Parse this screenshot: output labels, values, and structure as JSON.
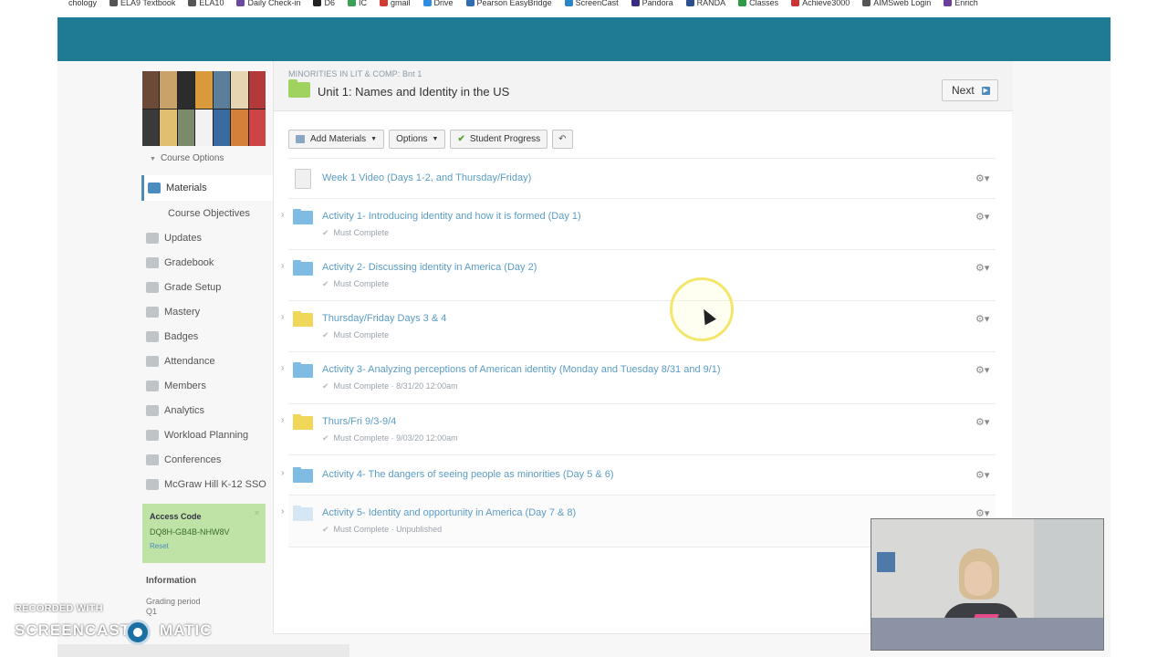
{
  "bookmarks": [
    {
      "label": "chology",
      "color": "#ffffff"
    },
    {
      "label": "ELA9 Textbook",
      "color": "#555555"
    },
    {
      "label": "ELA10",
      "color": "#555555"
    },
    {
      "label": "Daily Check-in",
      "color": "#6a4aa0"
    },
    {
      "label": "D6",
      "color": "#222222"
    },
    {
      "label": "IC",
      "color": "#3aa056"
    },
    {
      "label": "gmail",
      "color": "#d23c30"
    },
    {
      "label": "Drive",
      "color": "#2f8de2"
    },
    {
      "label": "Pearson EasyBridge",
      "color": "#2f6db0"
    },
    {
      "label": "ScreenCast",
      "color": "#2a84c6"
    },
    {
      "label": "Pandora",
      "color": "#3a2a80"
    },
    {
      "label": "RANDA",
      "color": "#2c4f8f"
    },
    {
      "label": "Classes",
      "color": "#2f9b46"
    },
    {
      "label": "Achieve3000",
      "color": "#cc3333"
    },
    {
      "label": "AIMSweb Login",
      "color": "#555555"
    },
    {
      "label": "Enrich",
      "color": "#6a3f9c"
    }
  ],
  "colors": {
    "header_band": "#1f7a94",
    "link": "#5a9cc4",
    "access_bg": "#bfe3a6"
  },
  "sidebar": {
    "course_options": "Course Options",
    "items": [
      {
        "label": "Materials",
        "icon": "materials-icon",
        "active": true
      },
      {
        "label": "Course Objectives",
        "icon": "",
        "sub": true
      },
      {
        "label": "Updates",
        "icon": "updates-icon"
      },
      {
        "label": "Gradebook",
        "icon": "gradebook-icon"
      },
      {
        "label": "Grade Setup",
        "icon": "grade-setup-icon"
      },
      {
        "label": "Mastery",
        "icon": "mastery-icon"
      },
      {
        "label": "Badges",
        "icon": "badges-icon"
      },
      {
        "label": "Attendance",
        "icon": "attendance-icon"
      },
      {
        "label": "Members",
        "icon": "members-icon"
      },
      {
        "label": "Analytics",
        "icon": "analytics-icon"
      },
      {
        "label": "Workload Planning",
        "icon": "workload-icon"
      },
      {
        "label": "Conferences",
        "icon": "conferences-icon"
      },
      {
        "label": "McGraw Hill K-12 SSO",
        "icon": "mcgraw-hill-icon"
      }
    ],
    "access_code": {
      "title": "Access Code",
      "code": "DQ8H-GB4B-NHW8V",
      "reset": "Reset"
    },
    "information": "Information",
    "grading_period": "Grading period",
    "grading_value": "Q1"
  },
  "header": {
    "breadcrumb": "MINORITIES IN LIT & COMP: Bnt 1",
    "title": "Unit 1: Names and Identity in the US",
    "next": "Next"
  },
  "toolbar": {
    "add_materials": "Add Materials",
    "options": "Options",
    "student_progress": "Student Progress"
  },
  "materials": [
    {
      "title": "Week 1 Video (Days 1-2, and Thursday/Friday)",
      "meta": "",
      "type": "doc"
    },
    {
      "title": "Activity 1- Introducing identity and how it is formed (Day 1)",
      "meta": "Must Complete",
      "type": "blue"
    },
    {
      "title": "Activity 2- Discussing identity in America (Day 2)",
      "meta": "Must Complete",
      "type": "blue"
    },
    {
      "title": "Thursday/Friday Days 3 & 4",
      "meta": "Must Complete",
      "type": "yellow"
    },
    {
      "title": "Activity 3- Analyzing perceptions of American identity (Monday and Tuesday 8/31 and 9/1)",
      "meta": "Must Complete · 8/31/20 12:00am",
      "type": "blue"
    },
    {
      "title": "Thurs/Fri 9/3-9/4",
      "meta": "Must Complete · 9/03/20 12:00am",
      "type": "yellow"
    },
    {
      "title": "Activity 4- The dangers of seeing people as minorities (Day 5 & 6)",
      "meta": "",
      "type": "blue"
    },
    {
      "title": "Activity 5- Identity and opportunity in America (Day 7 & 8)",
      "meta": "Must Complete ·     Unpublished",
      "type": "faded"
    }
  ],
  "watermark": {
    "recorded": "RECORDED WITH",
    "brand_left": "SCREENCAST",
    "brand_right": "MATIC"
  }
}
